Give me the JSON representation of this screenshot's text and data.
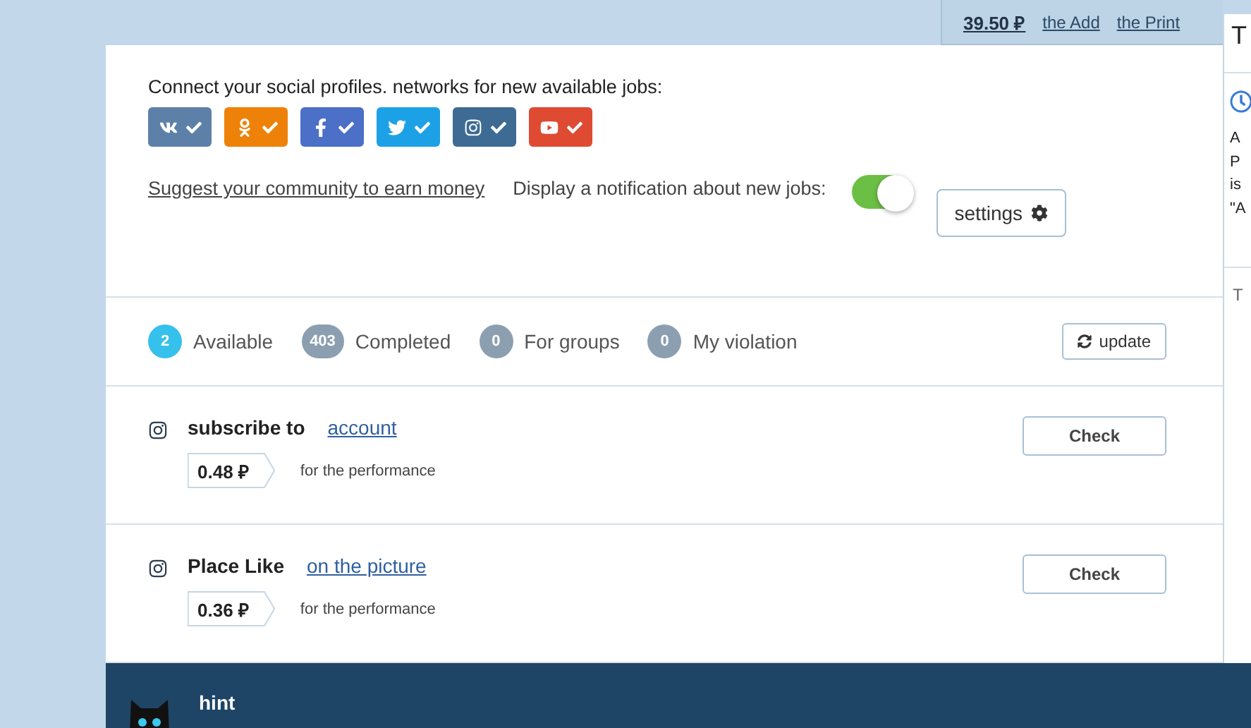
{
  "top_bar": {
    "balance": "39.50 ₽",
    "links": [
      "the Add",
      "the Print"
    ]
  },
  "social": {
    "heading": "Connect your social profiles. networks for new available jobs:",
    "networks": [
      {
        "kind": "vk",
        "color": "#5d80a8",
        "connected": true
      },
      {
        "kind": "ok",
        "color": "#ee8208",
        "connected": true
      },
      {
        "kind": "facebook",
        "color": "#4c6fc7",
        "connected": true
      },
      {
        "kind": "twitter",
        "color": "#1da1e6",
        "connected": true
      },
      {
        "kind": "instagram",
        "color": "#3e6b94",
        "connected": true
      },
      {
        "kind": "youtube",
        "color": "#df4a32",
        "connected": true
      }
    ],
    "suggest_link": "Suggest your community to earn money",
    "notify_label": "Display a notification about new jobs:",
    "notify_on": true,
    "settings_button": "settings"
  },
  "tabs": [
    {
      "count": "2",
      "label": "Available",
      "selected": true
    },
    {
      "count": "403",
      "label": "Completed",
      "selected": false
    },
    {
      "count": "0",
      "label": "For groups",
      "selected": false
    },
    {
      "count": "0",
      "label": "My violation",
      "selected": false
    }
  ],
  "update_button": "update",
  "tasks": [
    {
      "kind": "instagram",
      "action": "subscribe to",
      "link": "account",
      "price": "0.48 ₽",
      "note": "for the performance",
      "button": "Check"
    },
    {
      "kind": "instagram",
      "action": "Place Like",
      "link": "on the picture",
      "price": "0.36 ₽",
      "note": "for the performance",
      "button": "Check"
    }
  ],
  "side_panel": {
    "title": "T",
    "lines": [
      "A",
      "P",
      "is",
      "\"A"
    ],
    "footer": "T"
  },
  "hint": {
    "title": "hint"
  }
}
